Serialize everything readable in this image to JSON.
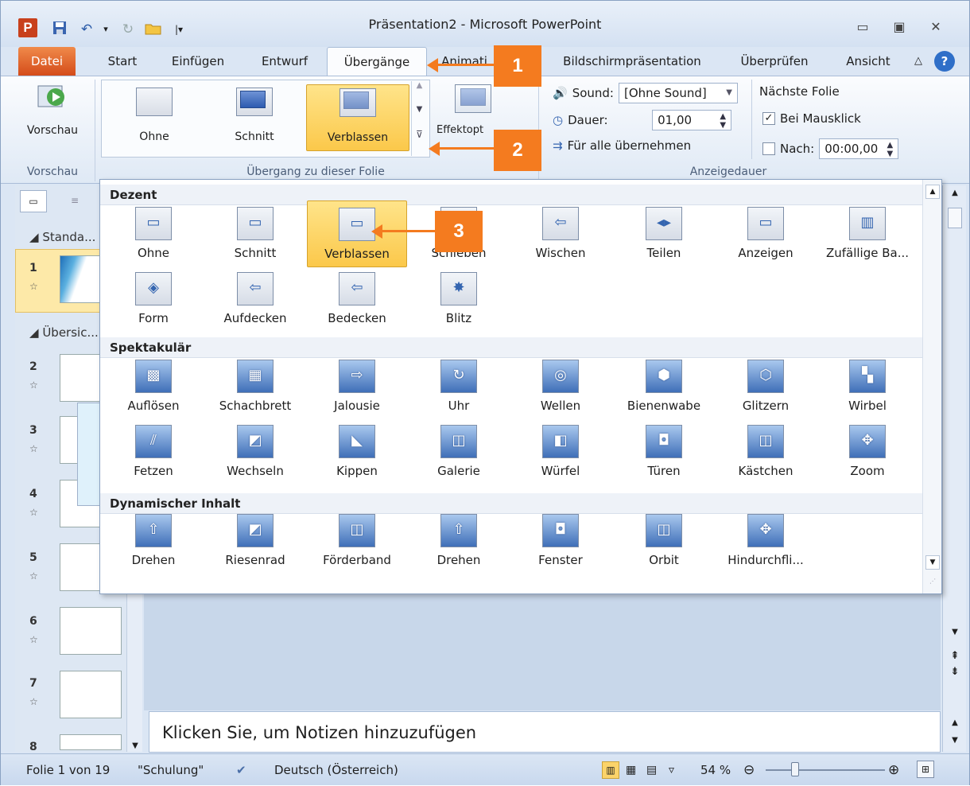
{
  "window": {
    "title": "Präsentation2 - Microsoft PowerPoint"
  },
  "tabs": {
    "file": "Datei",
    "start": "Start",
    "insert": "Einfügen",
    "design": "Entwurf",
    "transitions": "Übergänge",
    "animations": "Animati",
    "slideshow": "Bildschirmpräsentation",
    "review": "Überprüfen",
    "view": "Ansicht"
  },
  "ribbon": {
    "preview_label": "Vorschau",
    "preview_group": "Vorschau",
    "transition_group": "Übergang zu dieser Folie",
    "timing_group": "Anzeigedauer",
    "transitions": [
      "Ohne",
      "Schnitt",
      "Verblassen"
    ],
    "effect_options": "Effektopt",
    "sound_label": "Sound:",
    "sound_value": "[Ohne Sound]",
    "duration_label": "Dauer:",
    "duration_value": "01,00",
    "apply_all": "Für alle übernehmen",
    "next_slide": "Nächste Folie",
    "on_click": "Bei Mausklick",
    "after_label": "Nach:",
    "after_value": "00:00,00"
  },
  "gallery": {
    "sections": [
      {
        "title": "Dezent",
        "items": [
          "Ohne",
          "Schnitt",
          "Verblassen",
          "Schieben",
          "Wischen",
          "Teilen",
          "Anzeigen",
          "Zufällige Ba...",
          "Form",
          "Aufdecken",
          "Bedecken",
          "Blitz"
        ]
      },
      {
        "title": "Spektakulär",
        "items": [
          "Auflösen",
          "Schachbrett",
          "Jalousie",
          "Uhr",
          "Wellen",
          "Bienenwabe",
          "Glitzern",
          "Wirbel",
          "Fetzen",
          "Wechseln",
          "Kippen",
          "Galerie",
          "Würfel",
          "Türen",
          "Kästchen",
          "Zoom"
        ]
      },
      {
        "title": "Dynamischer Inhalt",
        "items": [
          "Drehen",
          "Riesenrad",
          "Förderband",
          "Drehen",
          "Fenster",
          "Orbit",
          "Hindurchfli..."
        ]
      }
    ]
  },
  "left_panel": {
    "section1": "Standa...",
    "section2": "Übersic...",
    "slide_numbers": [
      "1",
      "2",
      "3",
      "4",
      "5",
      "6",
      "7",
      "8"
    ]
  },
  "notes": {
    "placeholder": "Klicken Sie, um Notizen hinzuzufügen"
  },
  "status": {
    "slide_info": "Folie 1 von 19",
    "theme": "\"Schulung\"",
    "language": "Deutsch (Österreich)",
    "zoom": "54 %"
  },
  "callouts": [
    "1",
    "2",
    "3"
  ]
}
